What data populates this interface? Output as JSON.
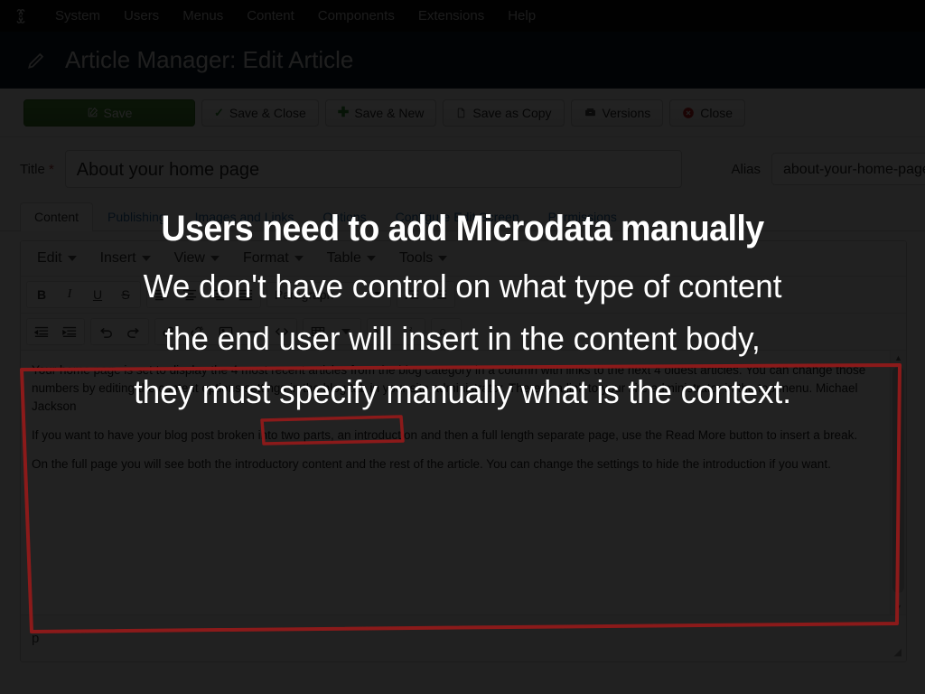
{
  "adminbar": {
    "logo_icon": "joomla-logo-icon",
    "items": [
      {
        "label": "System"
      },
      {
        "label": "Users"
      },
      {
        "label": "Menus"
      },
      {
        "label": "Content"
      },
      {
        "label": "Components"
      },
      {
        "label": "Extensions"
      },
      {
        "label": "Help"
      }
    ]
  },
  "pageheader": {
    "icon": "pencil-icon",
    "title": "Article Manager: Edit Article"
  },
  "toolbar": {
    "save_label": "Save",
    "save_close_label": "Save & Close",
    "save_new_label": "Save & New",
    "save_copy_label": "Save as Copy",
    "versions_label": "Versions",
    "close_label": "Close",
    "save_icon": "edit-square-icon",
    "save_close_icon": "check-icon",
    "save_new_icon": "plus-icon",
    "save_copy_icon": "copy-icon",
    "versions_icon": "archive-icon",
    "close_icon": "circle-x-icon",
    "primary_color": "#3d7d29",
    "close_color": "#cc3333"
  },
  "form": {
    "title_label": "Title",
    "title_required_mark": "*",
    "title_value": "About your home page",
    "title_placeholder": "Title",
    "alias_label": "Alias",
    "alias_value": "about-your-home-page",
    "alias_placeholder": "Alias"
  },
  "tabs": [
    {
      "label": "Content",
      "active": true
    },
    {
      "label": "Publishing",
      "active": false
    },
    {
      "label": "Images and Links",
      "active": false
    },
    {
      "label": "Options",
      "active": false
    },
    {
      "label": "Configure Edit Screen",
      "active": false
    },
    {
      "label": "Permissions",
      "active": false
    }
  ],
  "editor": {
    "menubar": [
      {
        "label": "Edit"
      },
      {
        "label": "Insert"
      },
      {
        "label": "View"
      },
      {
        "label": "Format"
      },
      {
        "label": "Table"
      },
      {
        "label": "Tools"
      }
    ],
    "toolbar_row1": {
      "bold": "B",
      "italic": "I",
      "underline": "U",
      "strikethrough": "S",
      "align_left_icon": "align-left-icon",
      "align_center_icon": "align-center-icon",
      "align_right_icon": "align-right-icon",
      "align_justify_icon": "align-justify-icon",
      "format_select_value": "Paragraph",
      "bullet_list_icon": "bullet-list-icon",
      "numbered_list_icon": "numbered-list-icon"
    },
    "toolbar_row2": {
      "outdent_icon": "outdent-icon",
      "indent_icon": "indent-icon",
      "undo_icon": "undo-icon",
      "redo_icon": "redo-icon",
      "link_icon": "link-icon",
      "unlink_icon": "unlink-icon",
      "image_icon": "image-icon",
      "hr_icon": "horizontal-rule-icon",
      "source_icon": "source-code-icon",
      "table_icon": "table-icon",
      "subscript_icon": "subscript-icon",
      "superscript_icon": "superscript-icon",
      "special_char_icon": "special-character-icon"
    },
    "body_paragraphs": [
      "Your home page is set to display the 4 most recent articles from the blog category in a column with links to the next 4 oldest articles. You can change those numbers by editing the content options settings in the blog tab in your site administrator. There is a link to your site administrator in the top menu. Michael Jackson",
      "If you want to have your blog post broken into two parts, an introduction and then a full length separate page, use the Read More button to insert a break.",
      "On the full page you will see both the introductory content and the rest of the article. You can change the settings to hide the introduction if you want."
    ],
    "status_path": "p",
    "scrollbar_up_icon": "triangle-up-icon",
    "scrollbar_down_icon": "triangle-down-icon",
    "resize_grip_icon": "resize-grip-icon"
  },
  "overlay": {
    "heading": "Users need to add Microdata manually",
    "body_line1": "We don't have control on what type of content",
    "body_line2": "the end user will insert in the content body,",
    "body_line3": "they must specify manually what is the context.",
    "text_color": "#ffffff",
    "dim_color": "rgba(0,0,0,0.865)"
  },
  "annotations": {
    "color": "#8b1a1a",
    "big_box_name": "editor-body-highlight-box",
    "small_box_name": "michael-jackson-highlight-box"
  }
}
